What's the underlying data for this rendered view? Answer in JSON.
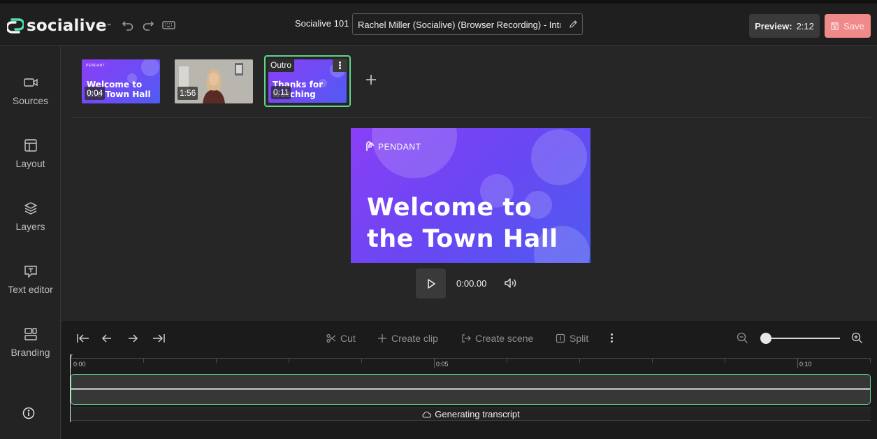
{
  "app": {
    "brand": "socialive",
    "project_name": "Socialive 101",
    "recording_title": "Rachel Miller (Socialive) (Browser Recording) - Introduction",
    "preview_label": "Preview:",
    "preview_duration": "2:12",
    "save_label": "Save"
  },
  "sidebar": {
    "items": [
      {
        "label": "Sources",
        "icon": "video-camera-icon"
      },
      {
        "label": "Layout",
        "icon": "layout-icon"
      },
      {
        "label": "Layers",
        "icon": "layers-icon"
      },
      {
        "label": "Text editor",
        "icon": "text-editor-icon"
      },
      {
        "label": "Branding",
        "icon": "branding-icon"
      }
    ]
  },
  "scenes": [
    {
      "duration": "0:04",
      "thumbnail_text": "Welcome to the Town Hall",
      "logo_text": "PENDANT"
    },
    {
      "duration": "1:56"
    },
    {
      "duration": "0:11",
      "tag": "Outro",
      "thumbnail_text": "Thanks for watching",
      "selected": true
    }
  ],
  "preview": {
    "logo_text": "PENDANT",
    "headline_line1": "Welcome to",
    "headline_line2": "the Town Hall",
    "timecode": "0:00.00"
  },
  "timeline": {
    "tools": {
      "cut": "Cut",
      "create_clip": "Create clip",
      "create_scene": "Create scene",
      "split": "Split"
    },
    "ruler_labels": [
      "0:00",
      "0:05",
      "0:10"
    ],
    "transcript_status": "Generating transcript",
    "zoom_level": 0
  },
  "colors": {
    "accent_green": "#5fd58c",
    "save_bg": "#f08a8a",
    "scene_purple": "#7a45f4"
  }
}
